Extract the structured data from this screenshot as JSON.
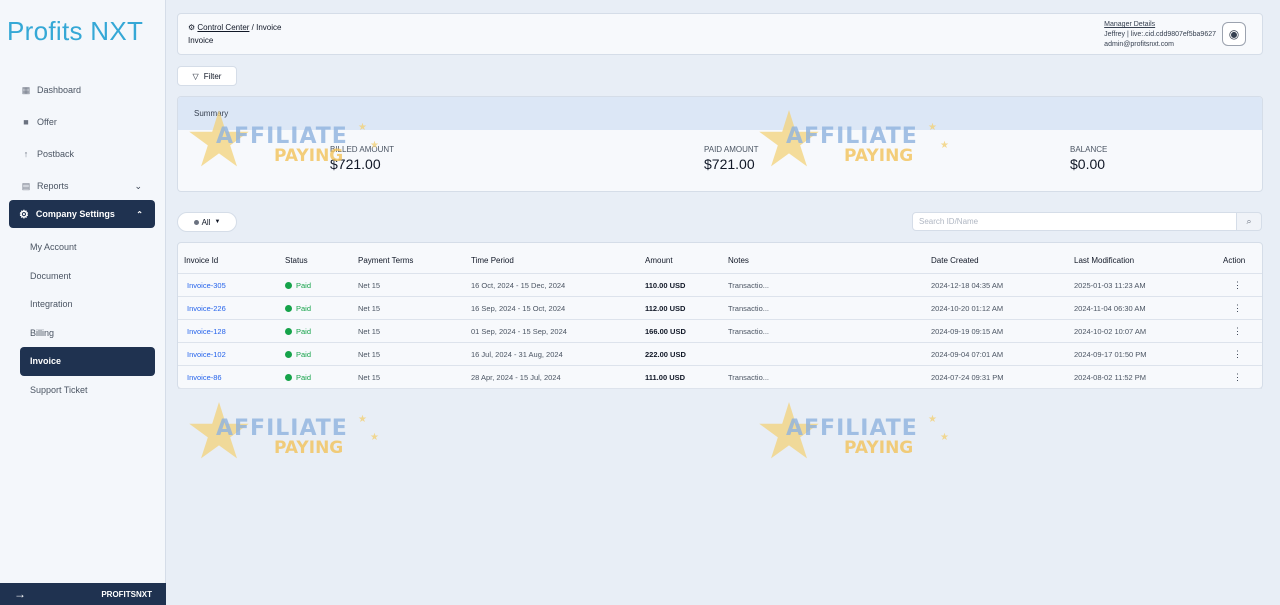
{
  "brand": "Profits NXT",
  "sidebar": {
    "items": [
      {
        "label": "Dashboard",
        "icon": "dashboard-icon"
      },
      {
        "label": "Offer",
        "icon": "folder-icon"
      },
      {
        "label": "Postback",
        "icon": "arrow-up-icon"
      },
      {
        "label": "Reports",
        "icon": "reports-icon"
      }
    ],
    "active_group": "Company Settings",
    "sub_items": [
      "My Account",
      "Document",
      "Integration",
      "Billing",
      "Invoice",
      "Support Ticket"
    ],
    "active_sub": "Invoice",
    "footer": "PROFITSNXT"
  },
  "header": {
    "crumb_root": "Control Center",
    "crumb_sep": " / ",
    "crumb_current": "Invoice",
    "title": "Invoice",
    "manager_title": "Manager Details",
    "manager_line1": "Jeffrey | live:.cid.cdd9807ef5ba9627",
    "manager_line2": "admin@profitsnxt.com"
  },
  "filter_label": "Filter",
  "summary": {
    "title": "Summary",
    "billed_label": "BILLED AMOUNT",
    "billed_value": "$721.00",
    "paid_label": "PAID AMOUNT",
    "paid_value": "$721.00",
    "balance_label": "BALANCE",
    "balance_value": "$0.00"
  },
  "all_label": "All",
  "search_placeholder": "Search ID/Name",
  "table": {
    "headers": [
      "Invoice Id",
      "Status",
      "Payment Terms",
      "Time Period",
      "Amount",
      "Notes",
      "Date Created",
      "Last Modification",
      "Action"
    ],
    "rows": [
      [
        "Invoice-305",
        "Paid",
        "Net 15",
        "16 Oct, 2024 - 15 Dec, 2024",
        "110.00 USD",
        "Transactio...",
        "2024-12-18 04:35 AM",
        "2025-01-03 11:23 AM",
        "⋮"
      ],
      [
        "Invoice-226",
        "Paid",
        "Net 15",
        "16 Sep, 2024 - 15 Oct, 2024",
        "112.00 USD",
        "Transactio...",
        "2024-10-20 01:12 AM",
        "2024-11-04 06:30 AM",
        "⋮"
      ],
      [
        "Invoice-128",
        "Paid",
        "Net 15",
        "01 Sep, 2024 - 15 Sep, 2024",
        "166.00 USD",
        "Transactio...",
        "2024-09-19 09:15 AM",
        "2024-10-02 10:07 AM",
        "⋮"
      ],
      [
        "Invoice-102",
        "Paid",
        "Net 15",
        "16 Jul, 2024 - 31 Aug, 2024",
        "222.00 USD",
        "",
        "2024-09-04 07:01 AM",
        "2024-09-17 01:50 PM",
        "⋮"
      ],
      [
        "Invoice-86",
        "Paid",
        "Net 15",
        "28 Apr, 2024 - 15 Jul, 2024",
        "111.00 USD",
        "Transactio...",
        "2024-07-24 09:31 PM",
        "2024-08-02 11:52 PM",
        "⋮"
      ]
    ]
  },
  "watermark": {
    "line1": "AFFILIATE",
    "line2": "PAYING"
  },
  "colors": {
    "brand": "#35a8d6",
    "nav_active": "#1f3250",
    "link": "#2563eb",
    "paid": "#16a34a"
  }
}
